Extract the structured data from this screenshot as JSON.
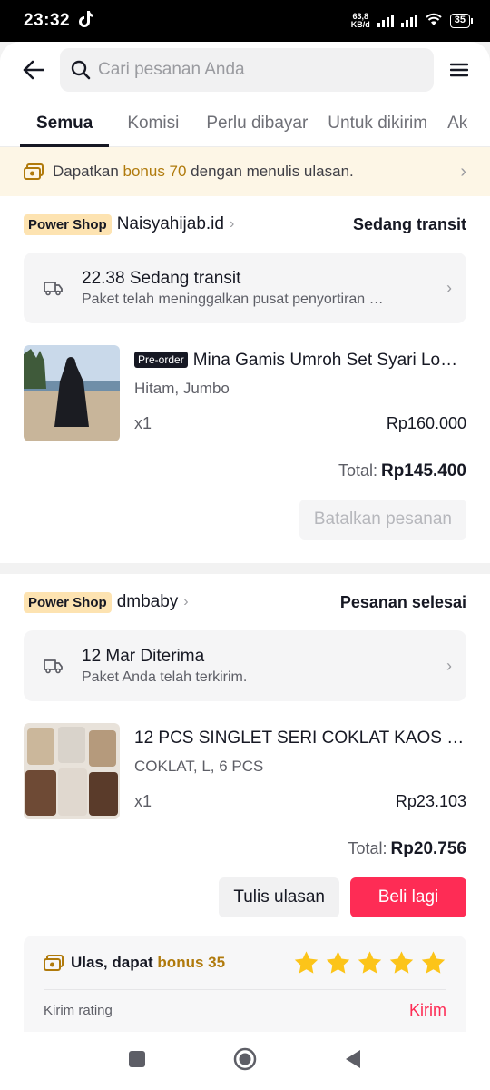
{
  "status_bar": {
    "time": "23:32",
    "net_speed_top": "63,8",
    "net_speed_bottom": "KB/d",
    "battery": "35"
  },
  "search": {
    "placeholder": "Cari pesanan Anda"
  },
  "tabs": [
    {
      "label": "Semua",
      "active": true
    },
    {
      "label": "Komisi"
    },
    {
      "label": "Perlu dibayar"
    },
    {
      "label": "Untuk dikirim"
    },
    {
      "label": "Ak"
    }
  ],
  "banner": {
    "prefix": "Dapatkan ",
    "bonus": "bonus 70",
    "suffix": " dengan menulis ulasan."
  },
  "orders": [
    {
      "badge": "Power Shop",
      "shop": "Naisyahijab.id",
      "status": "Sedang transit",
      "shipping_title": "22.38 Sedang transit",
      "shipping_sub": "Paket telah meninggalkan pusat penyortiran …",
      "preorder": "Pre-order",
      "product_name": "Mina Gamis Umroh Set Syari Lo…",
      "variant": "Hitam, Jumbo",
      "qty": "x1",
      "price": "Rp160.000",
      "total_label": "Total:",
      "total": "Rp145.400",
      "cancel_label": "Batalkan pesanan"
    },
    {
      "badge": "Power Shop",
      "shop": "dmbaby",
      "status": "Pesanan selesai",
      "shipping_title": "12 Mar Diterima",
      "shipping_sub": "Paket Anda telah terkirim.",
      "product_name": "12 PCS SINGLET SERI COKLAT KAOS …",
      "variant": "COKLAT, L, 6 PCS",
      "qty": "x1",
      "price": "Rp23.103",
      "total_label": "Total:",
      "total": "Rp20.756",
      "review_label": "Tulis ulasan",
      "rebuy_label": "Beli lagi",
      "rating_prefix": "Ulas, dapat ",
      "rating_bonus": "bonus 35",
      "rating_stars": 5,
      "rating_send_label": "Kirim rating",
      "rating_send_button": "Kirim"
    }
  ],
  "colors": {
    "accent": "#fe2c55",
    "gold": "#b07a0c",
    "power_badge": "#fde3b1",
    "banner_bg": "#fdf6e6",
    "star": "#fcc419"
  }
}
